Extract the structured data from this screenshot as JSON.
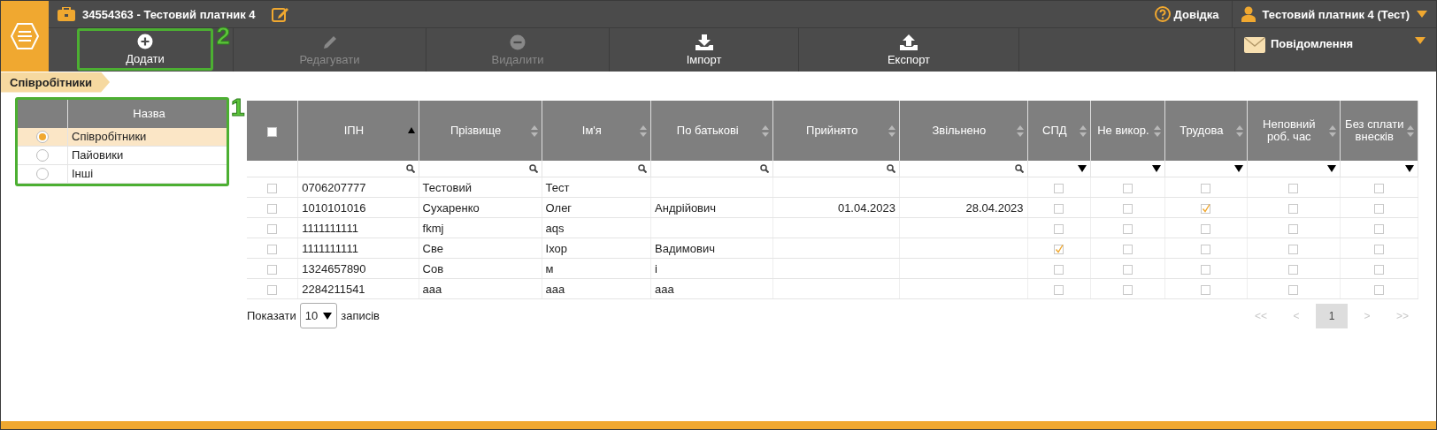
{
  "header": {
    "title": "34554363 - Тестовий платник 4",
    "help": "Довідка",
    "user": "Тестовий платник 4 (Тест)"
  },
  "toolbar": {
    "buttons": [
      {
        "label": "Додати",
        "disabled": false,
        "callout": "2"
      },
      {
        "label": "Редагувати",
        "disabled": true
      },
      {
        "label": "Видалити",
        "disabled": true
      },
      {
        "label": "Імпорт",
        "disabled": false
      },
      {
        "label": "Експорт",
        "disabled": false
      }
    ],
    "messages": "Повідомлення"
  },
  "breadcrumb": "Співробітники",
  "category_panel": {
    "callout": "1",
    "header": "Назва",
    "items": [
      {
        "label": "Співробітники",
        "selected": true
      },
      {
        "label": "Пайовики",
        "selected": false
      },
      {
        "label": "Інші",
        "selected": false
      }
    ]
  },
  "table": {
    "all_checked": false,
    "columns": [
      {
        "label": "ІПН",
        "kind": "text",
        "sorted": true
      },
      {
        "label": "Прізвище",
        "kind": "text",
        "sorted": false
      },
      {
        "label": "Ім'я",
        "kind": "text",
        "sorted": false
      },
      {
        "label": "По батькові",
        "kind": "text",
        "sorted": false
      },
      {
        "label": "Прийнято",
        "kind": "date",
        "sorted": false
      },
      {
        "label": "Звільнено",
        "kind": "date",
        "sorted": false
      },
      {
        "label": "СПД",
        "kind": "flag",
        "sorted": false
      },
      {
        "label": "Не викор.",
        "kind": "flag",
        "sorted": false
      },
      {
        "label": "Трудова",
        "kind": "flag",
        "sorted": false
      },
      {
        "label": "Неповний роб. час",
        "kind": "flag",
        "sorted": false
      },
      {
        "label": "Без сплати внесків",
        "kind": "flag",
        "sorted": false
      }
    ],
    "rows": [
      {
        "checked": false,
        "cells": [
          "0706207777",
          "Тестовий",
          "Тест",
          "",
          "",
          "",
          false,
          false,
          false,
          false,
          false
        ]
      },
      {
        "checked": false,
        "cells": [
          "1010101016",
          "Сухаренко",
          "Олег",
          "Андрійович",
          "01.04.2023",
          "28.04.2023",
          false,
          false,
          true,
          false,
          false
        ]
      },
      {
        "checked": false,
        "cells": [
          "1111111111",
          "fkmj",
          "aqs",
          "",
          "",
          "",
          false,
          false,
          false,
          false,
          false
        ]
      },
      {
        "checked": false,
        "cells": [
          "1111111111",
          "Све",
          "Іхор",
          "Вадимович",
          "",
          "",
          true,
          false,
          false,
          false,
          false
        ]
      },
      {
        "checked": false,
        "cells": [
          "1324657890",
          "Сов",
          "м",
          "і",
          "",
          "",
          false,
          false,
          false,
          false,
          false
        ]
      },
      {
        "checked": false,
        "cells": [
          "2284211541",
          "ааа",
          "ааа",
          "ааа",
          "",
          "",
          false,
          false,
          false,
          false,
          false
        ]
      }
    ]
  },
  "footer": {
    "show_label": "Показати",
    "page_size": "10",
    "records_label": "записів",
    "pages": [
      {
        "label": "<<",
        "disabled": true,
        "selected": false
      },
      {
        "label": "<",
        "disabled": true,
        "selected": false
      },
      {
        "label": "1",
        "disabled": false,
        "selected": true
      },
      {
        "label": ">",
        "disabled": true,
        "selected": false
      },
      {
        "label": ">>",
        "disabled": true,
        "selected": false
      }
    ]
  }
}
